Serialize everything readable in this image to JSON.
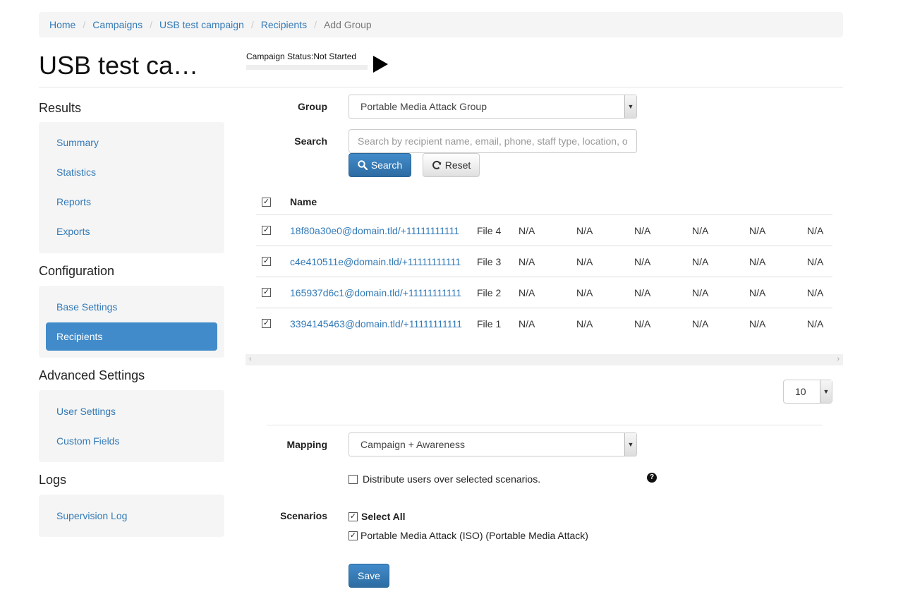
{
  "breadcrumb": [
    {
      "label": "Home"
    },
    {
      "label": "Campaigns"
    },
    {
      "label": "USB test campaign"
    },
    {
      "label": "Recipients"
    },
    {
      "label": "Add Group"
    }
  ],
  "page": {
    "title": "USB test ca…",
    "status_label": "Campaign Status:",
    "status_value": "Not Started",
    "start_icon": "play-icon"
  },
  "sidebar": {
    "results": {
      "heading": "Results",
      "items": [
        {
          "label": "Summary"
        },
        {
          "label": "Statistics"
        },
        {
          "label": "Reports"
        },
        {
          "label": "Exports"
        }
      ]
    },
    "configuration": {
      "heading": "Configuration",
      "items": [
        {
          "label": "Base Settings"
        },
        {
          "label": "Recipients",
          "active": true
        }
      ]
    },
    "advanced": {
      "heading": "Advanced Settings",
      "items": [
        {
          "label": "User Settings"
        },
        {
          "label": "Custom Fields"
        }
      ]
    },
    "logs": {
      "heading": "Logs",
      "items": [
        {
          "label": "Supervision Log"
        }
      ]
    }
  },
  "form": {
    "group_label": "Group",
    "group_value": "Portable Media Attack Group",
    "search_label": "Search",
    "search_placeholder": "Search by recipient name, email, phone, staff type, location, or department",
    "search_button": "Search",
    "reset_button": "Reset",
    "mapping_label": "Mapping",
    "mapping_value": "Campaign + Awareness",
    "distribute_label": "Distribute users over selected scenarios.",
    "distribute_checked": false,
    "help_icon": "question-circle-icon",
    "scenarios_label": "Scenarios",
    "select_all_label": "Select All",
    "select_all_checked": true,
    "scenario_option": "Portable Media Attack (ISO) (Portable Media Attack)",
    "scenario_checked": true,
    "save_button": "Save"
  },
  "table": {
    "columns": [
      "Name"
    ],
    "header_checked": true,
    "rows": [
      {
        "checked": true,
        "name": "18f80a30e0@domain.tld/+11111111111",
        "file": "File 4",
        "values": [
          "N/A",
          "N/A",
          "N/A",
          "N/A",
          "N/A",
          "N/A"
        ]
      },
      {
        "checked": true,
        "name": "c4e410511e@domain.tld/+11111111111",
        "file": "File 3",
        "values": [
          "N/A",
          "N/A",
          "N/A",
          "N/A",
          "N/A",
          "N/A"
        ]
      },
      {
        "checked": true,
        "name": "165937d6c1@domain.tld/+11111111111",
        "file": "File 2",
        "values": [
          "N/A",
          "N/A",
          "N/A",
          "N/A",
          "N/A",
          "N/A"
        ]
      },
      {
        "checked": true,
        "name": "3394145463@domain.tld/+11111111111",
        "file": "File 1",
        "values": [
          "N/A",
          "N/A",
          "N/A",
          "N/A",
          "N/A",
          "N/A"
        ]
      }
    ]
  },
  "pagination": {
    "page_size": "10"
  }
}
